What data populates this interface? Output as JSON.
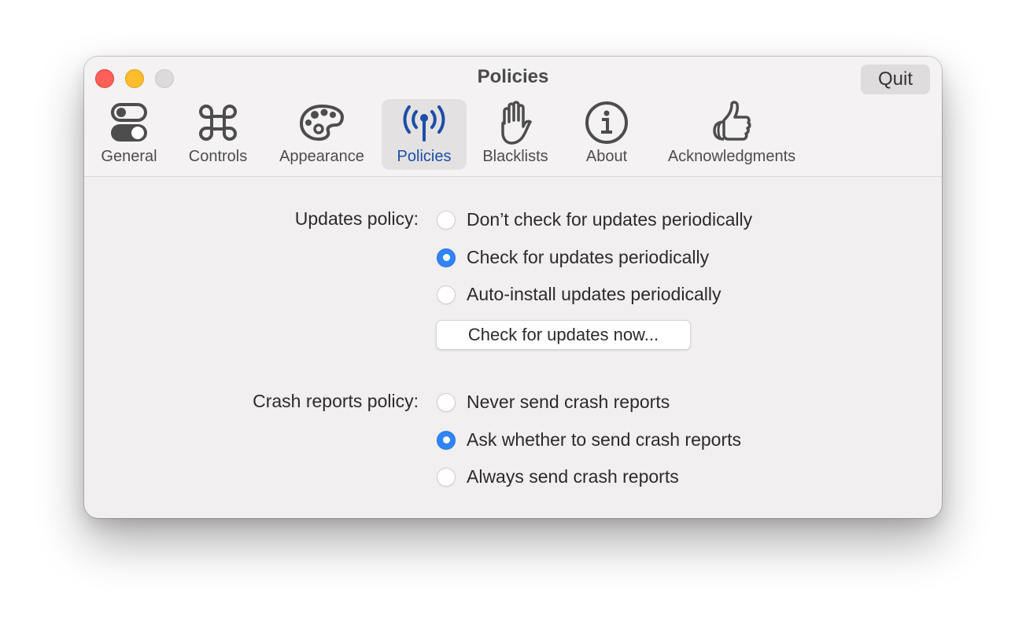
{
  "window": {
    "title": "Policies",
    "quit_label": "Quit"
  },
  "tabs": [
    {
      "label": "General",
      "icon": "toggle-switches-icon",
      "selected": false
    },
    {
      "label": "Controls",
      "icon": "command-key-icon",
      "selected": false
    },
    {
      "label": "Appearance",
      "icon": "palette-icon",
      "selected": false
    },
    {
      "label": "Policies",
      "icon": "antenna-broadcast-icon",
      "selected": true
    },
    {
      "label": "Blacklists",
      "icon": "raised-hand-icon",
      "selected": false
    },
    {
      "label": "About",
      "icon": "info-circle-icon",
      "selected": false
    },
    {
      "label": "Acknowledgments",
      "icon": "thumbs-up-icon",
      "selected": false
    }
  ],
  "updates": {
    "label": "Updates policy:",
    "options": [
      {
        "label": "Don’t check for updates periodically",
        "checked": false
      },
      {
        "label": "Check for updates periodically",
        "checked": true
      },
      {
        "label": "Auto-install updates periodically",
        "checked": false
      }
    ],
    "check_now_label": "Check for updates now..."
  },
  "crash_reports": {
    "label": "Crash reports policy:",
    "options": [
      {
        "label": "Never send crash reports",
        "checked": false
      },
      {
        "label": "Ask whether to send crash reports",
        "checked": true
      },
      {
        "label": "Always send crash reports",
        "checked": false
      }
    ]
  },
  "colors": {
    "accent": "#2f84f6",
    "selected_tab_text": "#1c4ea5",
    "window_bg": "#f1eff0"
  }
}
